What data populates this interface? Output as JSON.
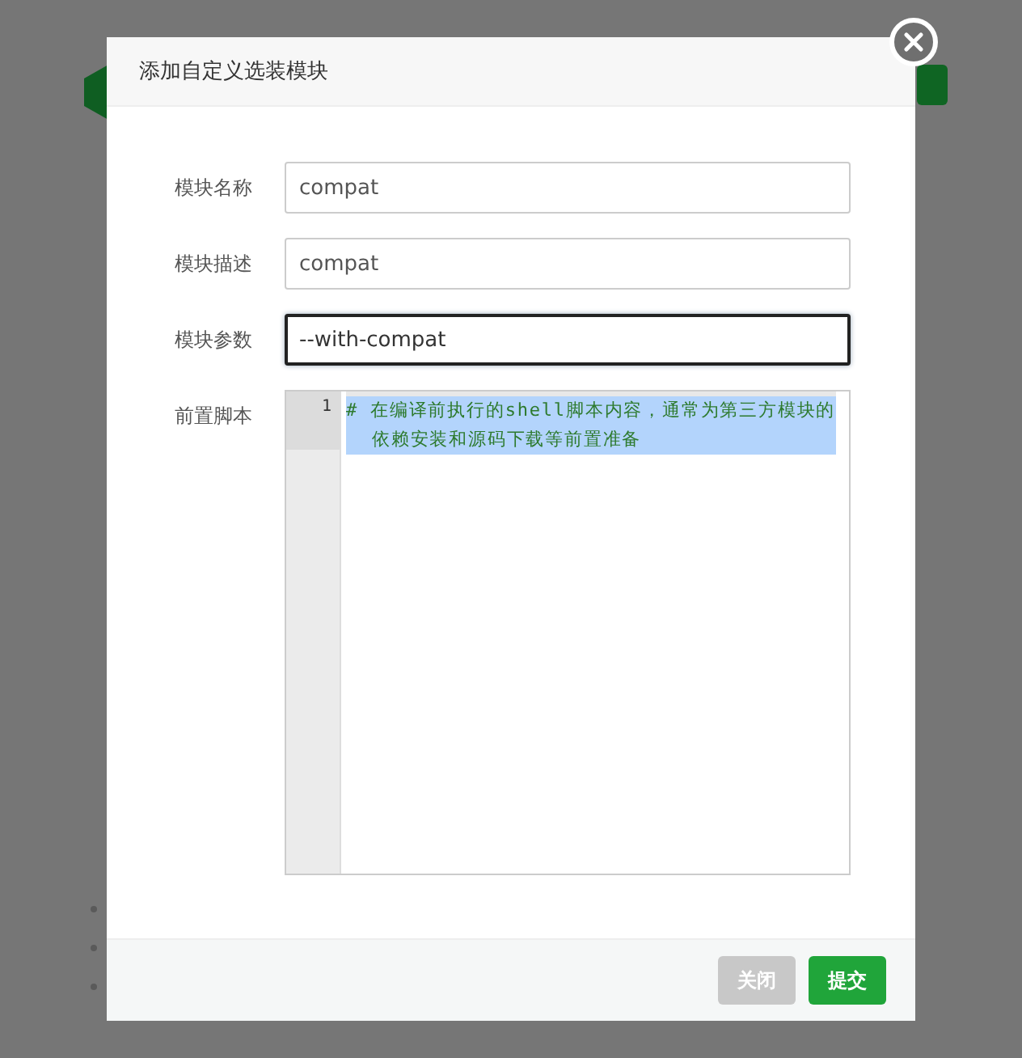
{
  "dialog": {
    "title": "添加自定义选装模块",
    "fields": [
      {
        "label": "模块名称",
        "value": "compat",
        "focused": false
      },
      {
        "label": "模块描述",
        "value": "compat",
        "focused": false
      },
      {
        "label": "模块参数",
        "value": "--with-compat",
        "focused": true
      }
    ],
    "script_editor": {
      "label": "前置脚本",
      "lines": [
        {
          "number": "1",
          "text": "# 在编译前执行的shell脚本内容，通常为第三方模块的依赖安装和源码下载等前置准备",
          "selected": true
        }
      ]
    },
    "buttons": [
      {
        "label": "关闭",
        "kind": "secondary"
      },
      {
        "label": "提交",
        "kind": "primary"
      }
    ]
  }
}
